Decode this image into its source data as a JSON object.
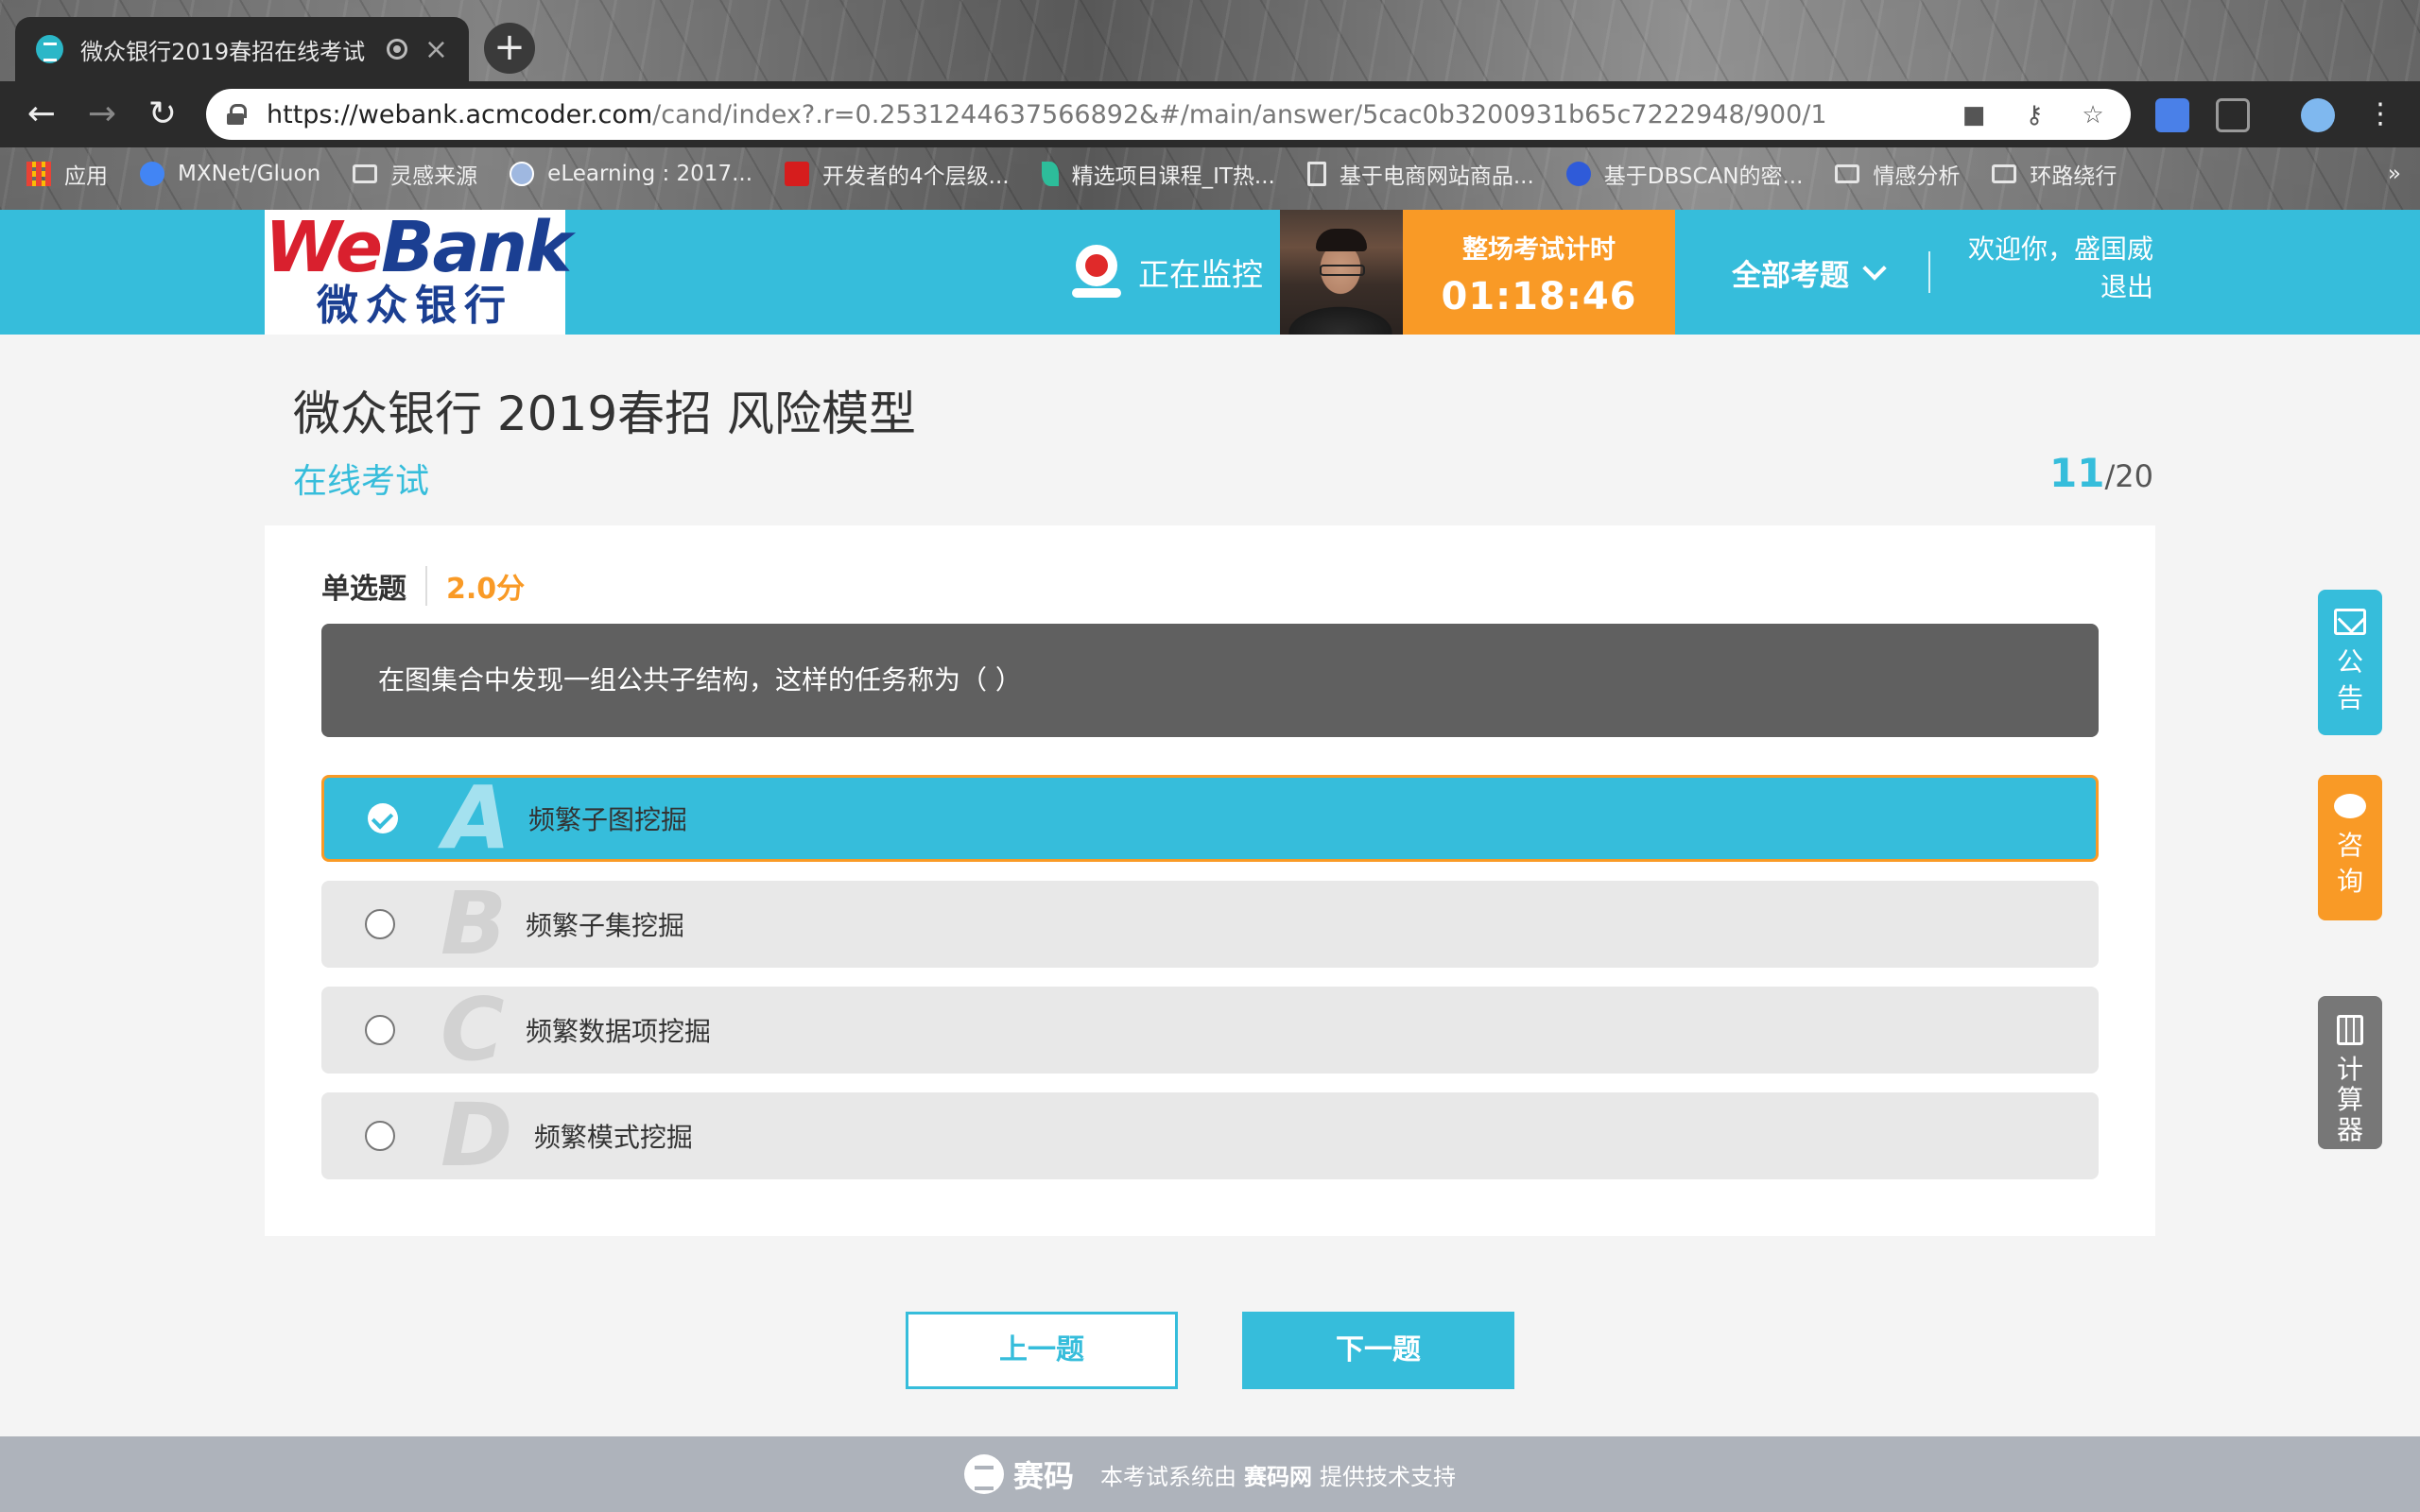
{
  "browser": {
    "tab_title": "微众银行2019春招在线考试",
    "new_tab_icon": "+",
    "url_host": "https://webank.acmcoder.com",
    "url_path": "/cand/index?.r=0.2531244637566892&#/main/answer/5cac0b3200931b65c7222948/900/1",
    "bookmarks": [
      {
        "label": "应用",
        "icon": "apps-grid-icon"
      },
      {
        "label": "MXNet/Gluon",
        "icon": "g-icon"
      },
      {
        "label": "灵感来源",
        "icon": "folder-icon"
      },
      {
        "label": "eLearning : 2017...",
        "icon": "globe-icon"
      },
      {
        "label": "开发者的4个层级...",
        "icon": "c-icon"
      },
      {
        "label": "精选项目课程_IT热...",
        "icon": "leaf-icon"
      },
      {
        "label": "基于电商网站商品...",
        "icon": "page-icon"
      },
      {
        "label": "基于DBSCAN的密...",
        "icon": "paw-icon"
      },
      {
        "label": "情感分析",
        "icon": "folder-icon"
      },
      {
        "label": "环路绕行",
        "icon": "folder-icon"
      }
    ],
    "more_bookmarks": "»"
  },
  "header": {
    "logo_en_we": "We",
    "logo_en_bank": "Bank",
    "logo_cn": "微众银行",
    "monitor_label": "正在监控",
    "timer_label": "整场考试计时",
    "timer_value": "01:18:46",
    "all_questions": "全部考题",
    "welcome": "欢迎你，盛国威",
    "logout": "退出"
  },
  "exam": {
    "title": "微众银行 2019春招 风险模型",
    "subtitle": "在线考试",
    "current": "11",
    "total": "/20"
  },
  "question": {
    "type": "单选题",
    "score": "2.0分",
    "stem": "在图集合中发现一组公共子结构，这样的任务称为（   ）",
    "selected_index": 0,
    "options": [
      {
        "letter": "A",
        "text": "频繁子图挖掘"
      },
      {
        "letter": "B",
        "text": "频繁子集挖掘"
      },
      {
        "letter": "C",
        "text": "频繁数据项挖掘"
      },
      {
        "letter": "D",
        "text": " 频繁模式挖掘"
      }
    ]
  },
  "nav": {
    "prev": "上一题",
    "next": "下一题"
  },
  "sidebar": {
    "notice_line1": "公",
    "notice_line2": "告",
    "consult_line1": "咨",
    "consult_line2": "询",
    "calc_line1": "计",
    "calc_line2": "算",
    "calc_line3": "器",
    "colors": {
      "notice": "#36bddb",
      "consult": "#f99a26",
      "calc": "#777777"
    }
  },
  "footer": {
    "brand": "赛码",
    "text_pre": "本考试系统由",
    "text_brand": "赛码网",
    "text_post": "提供技术支持"
  },
  "colors": {
    "accent": "#36bddb",
    "timer": "#f99a26",
    "logo_red": "#d9202e",
    "logo_blue": "#1b3f92"
  }
}
